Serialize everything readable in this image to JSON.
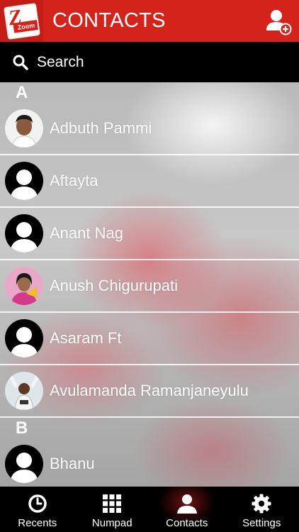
{
  "header": {
    "title": "CONTACTS",
    "logo_text": "Zoom"
  },
  "search": {
    "label": "Search"
  },
  "sections": [
    {
      "letter": "A",
      "contacts": [
        {
          "name": "Adbuth Pammi",
          "avatar": "photo-portrait"
        },
        {
          "name": "Aftayta",
          "avatar": "default-silhouette"
        },
        {
          "name": "Anant Nag",
          "avatar": "default-silhouette"
        },
        {
          "name": "Anush Chigurupati",
          "avatar": "photo-portrait"
        },
        {
          "name": "Asaram Ft",
          "avatar": "default-silhouette"
        },
        {
          "name": "Avulamanda Ramanjaneyulu",
          "avatar": "photo-portrait"
        }
      ]
    },
    {
      "letter": "B",
      "contacts": [
        {
          "name": "Bhanu",
          "avatar": "default-silhouette"
        }
      ]
    }
  ],
  "tabs": [
    {
      "label": "Recents",
      "icon": "clock-icon",
      "active": false
    },
    {
      "label": "Numpad",
      "icon": "grid-icon",
      "active": false
    },
    {
      "label": "Contacts",
      "icon": "person-icon",
      "active": true
    },
    {
      "label": "Settings",
      "icon": "gear-icon",
      "active": false
    }
  ],
  "colors": {
    "header": "#d4231a",
    "accent": "#c41d15"
  }
}
